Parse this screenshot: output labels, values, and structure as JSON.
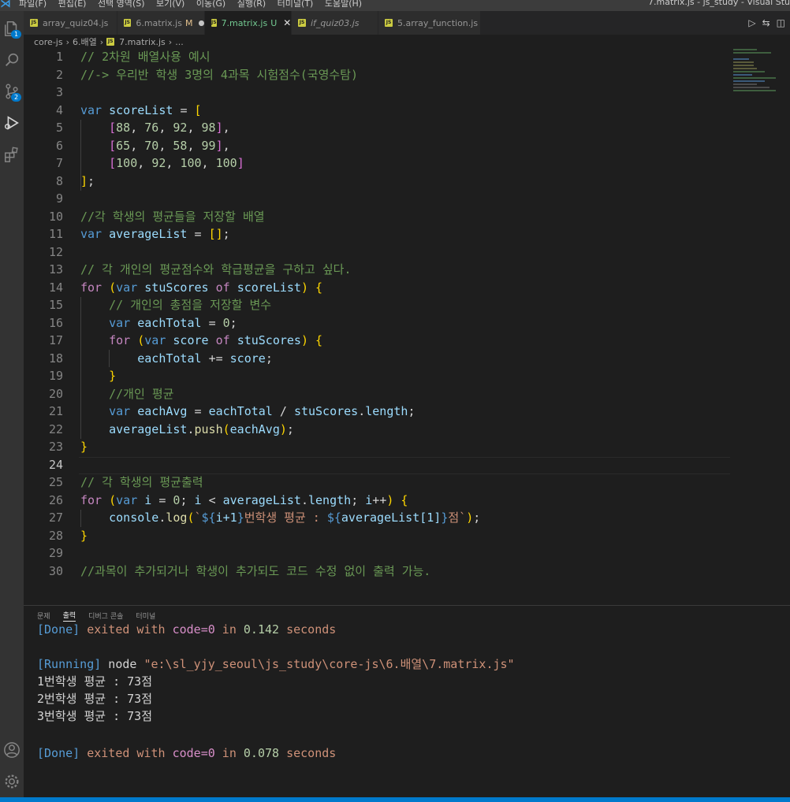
{
  "titlebar": {
    "menus": [
      "파일(F)",
      "편집(E)",
      "선택 영역(S)",
      "보기(V)",
      "이동(G)",
      "실행(R)",
      "터미널(T)",
      "도움말(H)"
    ],
    "title": "7.matrix.js - js_study - Visual Stu"
  },
  "activity": {
    "explorer_badge": "1",
    "scm_badge": "2"
  },
  "tabs": [
    {
      "label": "array_quiz04.js",
      "state": ""
    },
    {
      "label": "6.matrix.js",
      "state": "M"
    },
    {
      "label": "7.matrix.js",
      "state": "U"
    },
    {
      "label": "if_quiz03.js",
      "state": ""
    },
    {
      "label": "5.array_function.js",
      "state": ""
    }
  ],
  "breadcrumb": [
    "core-js",
    "6.배열",
    "7.matrix.js",
    "..."
  ],
  "editor": {
    "current_line": 24,
    "lines": [
      "// 2차원 배열사용 예시",
      "//-> 우리반 학생 3명의 4과목 시험점수(국영수탐)",
      "",
      "var scoreList = [",
      "    [88, 76, 92, 98],",
      "    [65, 70, 58, 99],",
      "    [100, 92, 100, 100]",
      "];",
      "",
      "//각 학생의 평균들을 저장할 배열",
      "var averageList = [];",
      "",
      "// 각 개인의 평균점수와 학급평균을 구하고 싶다.",
      "for (var stuScores of scoreList) {",
      "    // 개인의 총점을 저장할 변수",
      "    var eachTotal = 0;",
      "    for (var score of stuScores) {",
      "        eachTotal += score;",
      "    }",
      "    //개인 평균",
      "    var eachAvg = eachTotal / stuScores.length;",
      "    averageList.push(eachAvg);",
      "}",
      "",
      "// 각 학생의 평균출력",
      "for (var i = 0; i < averageList.length; i++) {",
      "    console.log(`${i+1}번학생 평균 : ${averageList[1]}점`);",
      "}",
      "",
      "//과목이 추가되거나 학생이 추가되도 코드 수정 없이 출력 가능."
    ]
  },
  "panel": {
    "tabs": [
      "문제",
      "출력",
      "디버그 콘솔",
      "터미널"
    ],
    "active_tab": "출력",
    "output": {
      "done1_tag": "[Done]",
      "done1_msg": " exited with ",
      "done1_code": "code=0",
      "done1_in": " in ",
      "done1_time": "0.142",
      "done1_sec": " seconds",
      "running_tag": "[Running]",
      "running_cmd": " node ",
      "running_path": "\"e:\\sl_yjy_seoul\\js_study\\core-js\\6.배열\\7.matrix.js\"",
      "result_lines": [
        "1번학생 평균 : 73점",
        "2번학생 평균 : 73점",
        "3번학생 평균 : 73점"
      ],
      "done2_tag": "[Done]",
      "done2_msg": " exited with ",
      "done2_code": "code=0",
      "done2_in": " in ",
      "done2_time": "0.078",
      "done2_sec": " seconds"
    }
  },
  "colors": {
    "accent": "#007acc",
    "editor_bg": "#1e1e1e",
    "comment": "#6a9955",
    "keyword": "#569cd6"
  }
}
